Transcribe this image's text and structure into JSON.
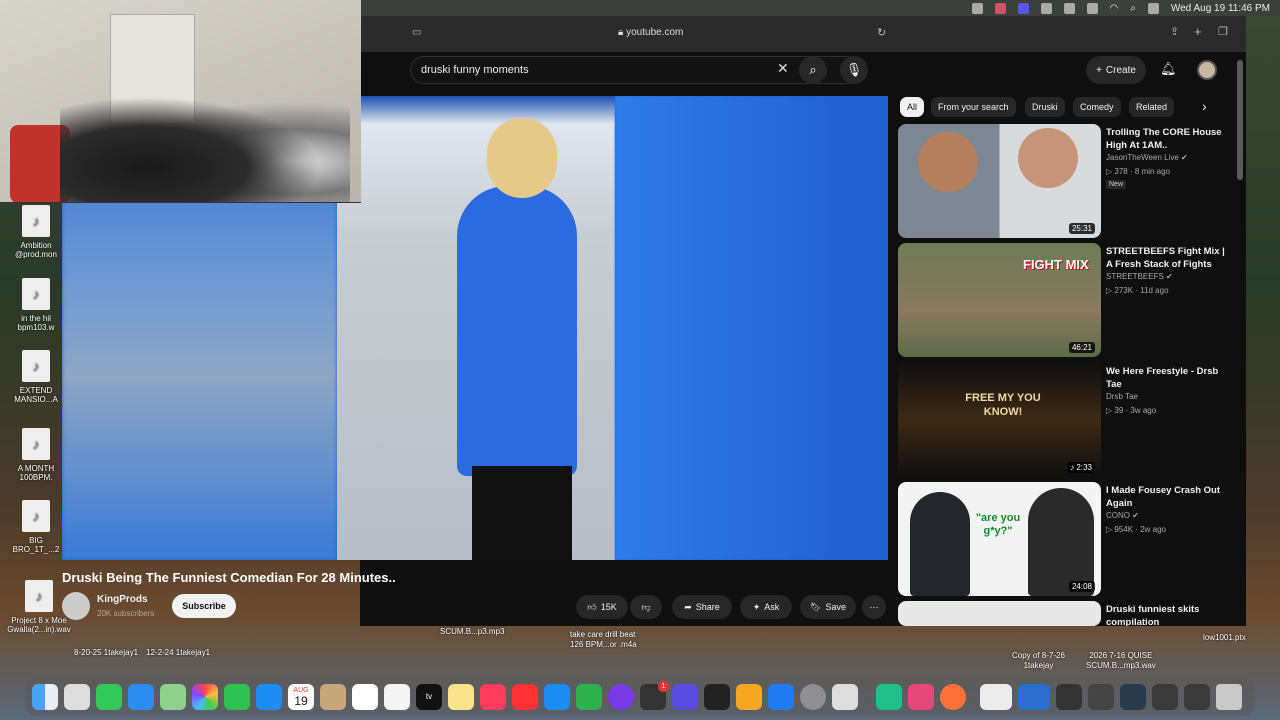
{
  "menubar": {
    "datetime": "Wed Aug 19  11:46 PM"
  },
  "browser": {
    "url": "youtube.com"
  },
  "header": {
    "search_value": "druski funny moments",
    "create_label": "Create"
  },
  "chips": [
    "All",
    "From your search",
    "Druski",
    "Comedy",
    "Related"
  ],
  "video": {
    "title": "Druski Being The Funniest Comedian For 28 Minutes..",
    "channel": "KingProds",
    "subscribers": "20K subscribers",
    "subscribe_label": "Subscribe",
    "likes": "15K",
    "share_label": "Share",
    "ask_label": "Ask",
    "save_label": "Save"
  },
  "recommendations": [
    {
      "title": "Trolling The CORE House High At 1AM..",
      "channel": "JasonTheWeen Live",
      "views": "378",
      "age": "8 min ago",
      "badge": "New",
      "duration": "25:31"
    },
    {
      "title": "STREETBEEFS Fight Mix | A Fresh Stack of Fights",
      "channel": "STREETBEEFS",
      "views": "273K",
      "age": "11d ago",
      "duration": "46:21",
      "thumb_text": "FIGHT MIX"
    },
    {
      "title": "We Here Freestyle - Drsb Tae",
      "channel": "Drsb Tae",
      "views": "39",
      "age": "3w ago",
      "duration": "2:33",
      "thumb_text": "FREE MY YOU KNOW!"
    },
    {
      "title": "I Made Fousey Crash Out Again",
      "channel": "CONO",
      "views": "954K",
      "age": "2w ago",
      "duration": "24:08",
      "thumb_text": "\"are you g*y?\""
    },
    {
      "title": "Druski funniest skits compilation",
      "channel": "",
      "views": "",
      "age": "",
      "duration": ""
    }
  ],
  "desktop_icons": [
    {
      "label": "Ambition\n@prod.mon"
    },
    {
      "label": "in the hil\nbpm103.w"
    },
    {
      "label": "EXTEND\nMANSIO...A"
    },
    {
      "label": "A MONTH\n100BPM."
    },
    {
      "label": "BIG\nBRO_1T_...2"
    },
    {
      "label": "Project 8 x Moe\nGwalla(2...in).wav"
    }
  ],
  "desktop_files": [
    {
      "label": "8-20-25 1takejay1"
    },
    {
      "label": "12-2-24 1takejay1"
    },
    {
      "label": "take care drill beat\n126 BPM...or .m4a"
    },
    {
      "label": "SCUM.B...p3.mp3"
    },
    {
      "label": "Copy of 8-7-26\n1takejay"
    },
    {
      "label": "2026 7-16 QUISE\nSCUM.B...mp3.wav"
    },
    {
      "label": "low1001.ptx"
    }
  ],
  "dock": {
    "calendar_day": "19",
    "calendar_month": "AUG",
    "badge_count": "1"
  },
  "colors": {
    "youtube_bg": "#0f0f0f",
    "chip_active": "#f1f1f1",
    "video_blue": "#1d64c9",
    "subscribe_bg": "#f1f1f1"
  }
}
